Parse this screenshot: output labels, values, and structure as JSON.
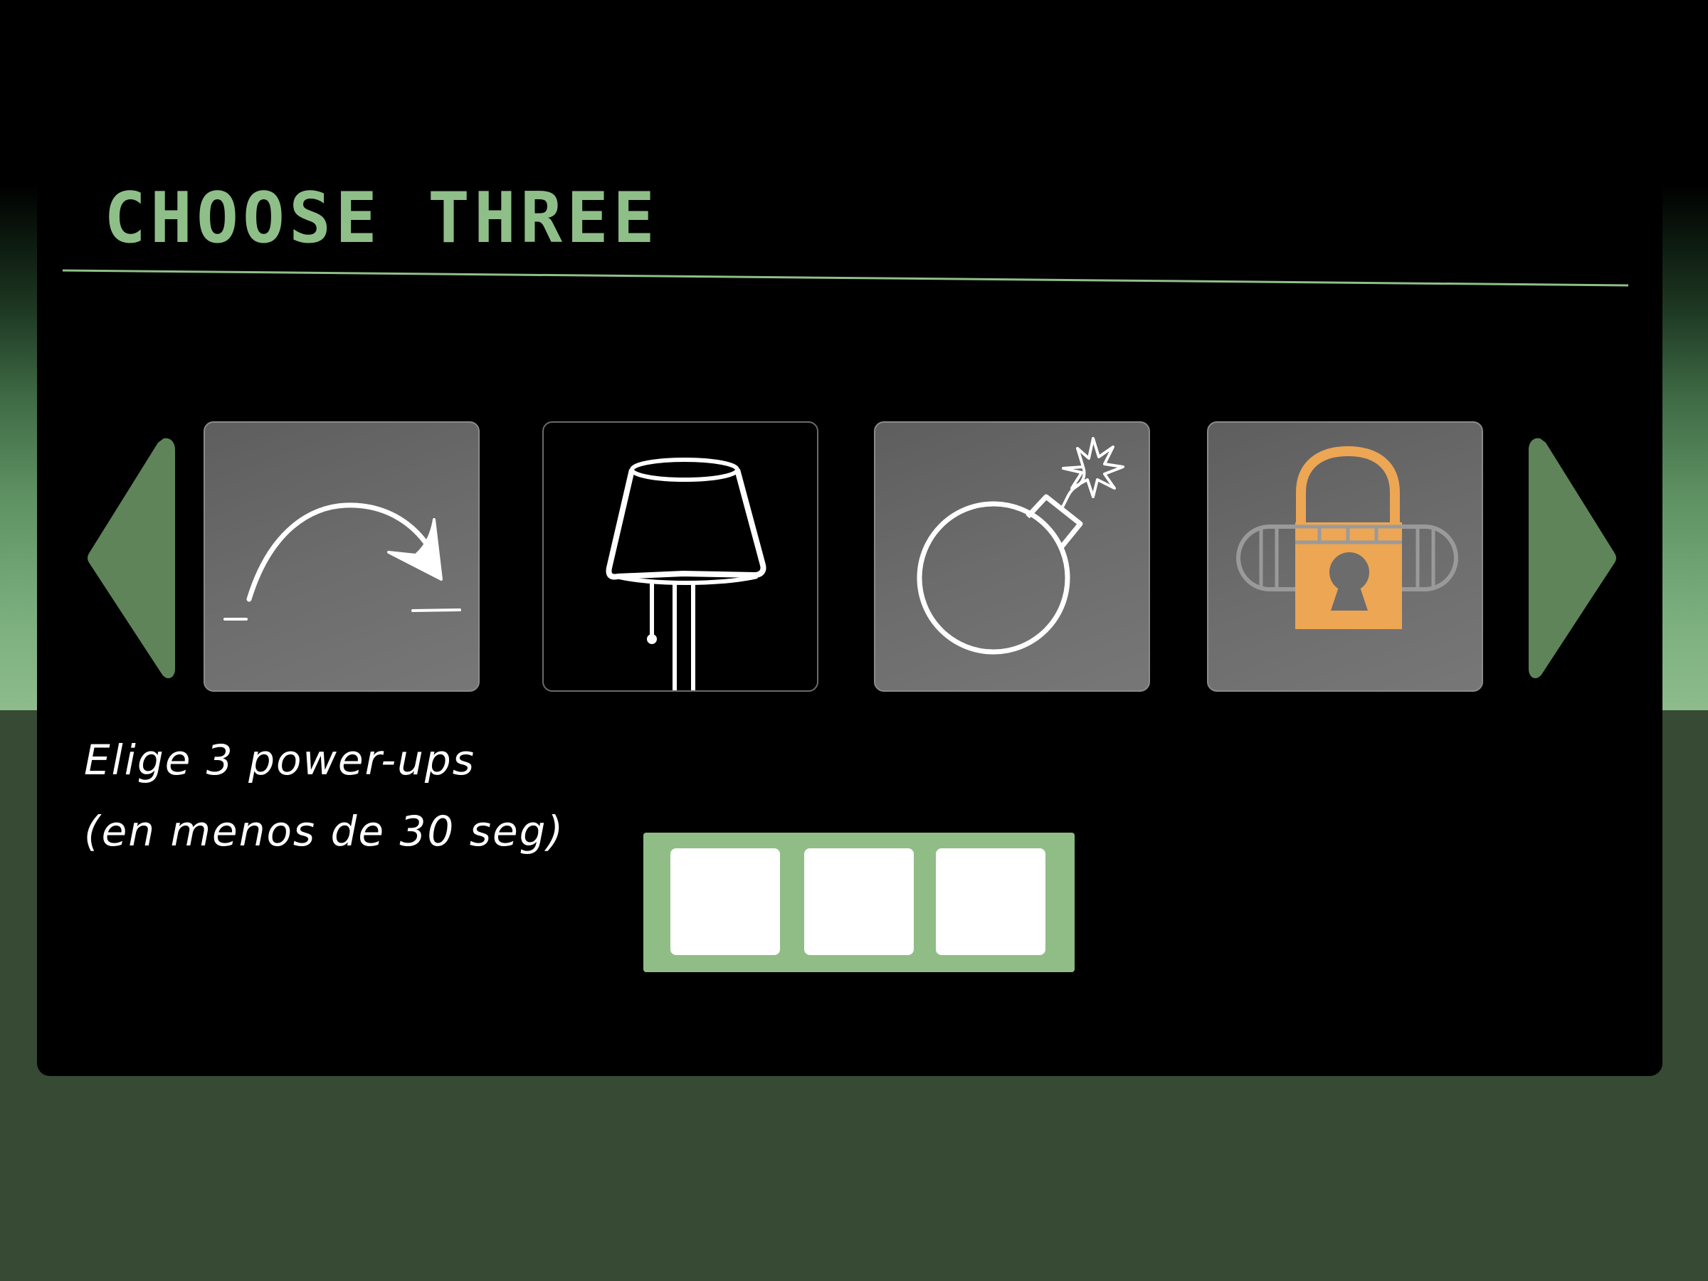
{
  "screen": {
    "title": "CHOOSE THREE",
    "hint_line_1": "Elige 3 power-ups",
    "hint_line_2": "(en menos de 30 seg)"
  },
  "colors": {
    "accent_green": "#8fbf88",
    "slot_frame": "#90bd86",
    "arrow_green": "#5f845a",
    "lock_orange": "#eda654",
    "card_grey": "#6c6c6c",
    "background_bottom": "#364a34"
  },
  "carousel": {
    "prev_icon": "left-triangle-arrow",
    "next_icon": "right-triangle-arrow",
    "cards": [
      {
        "icon": "jump-arc-icon",
        "style": "grey"
      },
      {
        "icon": "lamp-icon",
        "style": "dark"
      },
      {
        "icon": "bomb-icon",
        "style": "grey"
      },
      {
        "icon": "lock-icon",
        "style": "grey"
      }
    ]
  },
  "selection": {
    "slots_total": 3,
    "slots_filled": 0
  }
}
